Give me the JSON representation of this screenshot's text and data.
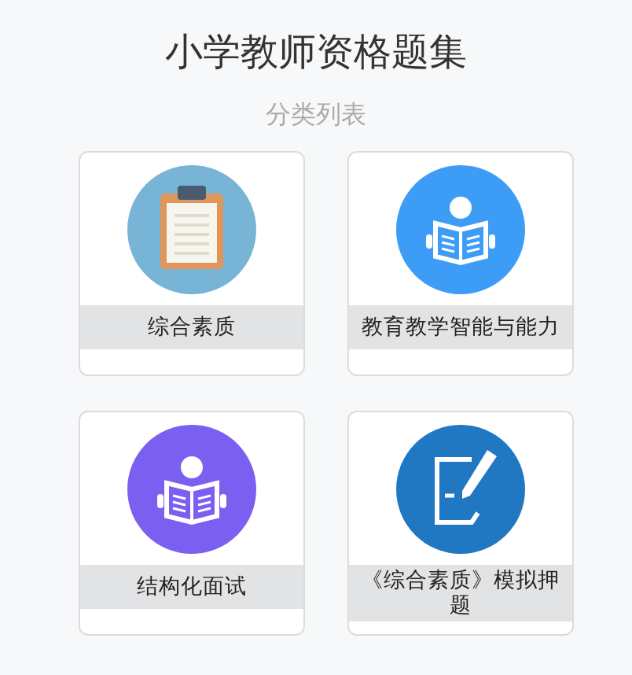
{
  "header": {
    "title": "小学教师资格题集",
    "subtitle": "分类列表"
  },
  "categories": [
    {
      "label": "综合素质",
      "kind": "clipboard",
      "color": "#78b4d6"
    },
    {
      "label": "教育教学智能与能力",
      "kind": "reader",
      "color": "#3d9cf5"
    },
    {
      "label": "结构化面试",
      "kind": "reader",
      "color": "#7b5ff0"
    },
    {
      "label": "《综合素质》模拟押题",
      "kind": "signing",
      "color": "#1f78c1"
    }
  ]
}
